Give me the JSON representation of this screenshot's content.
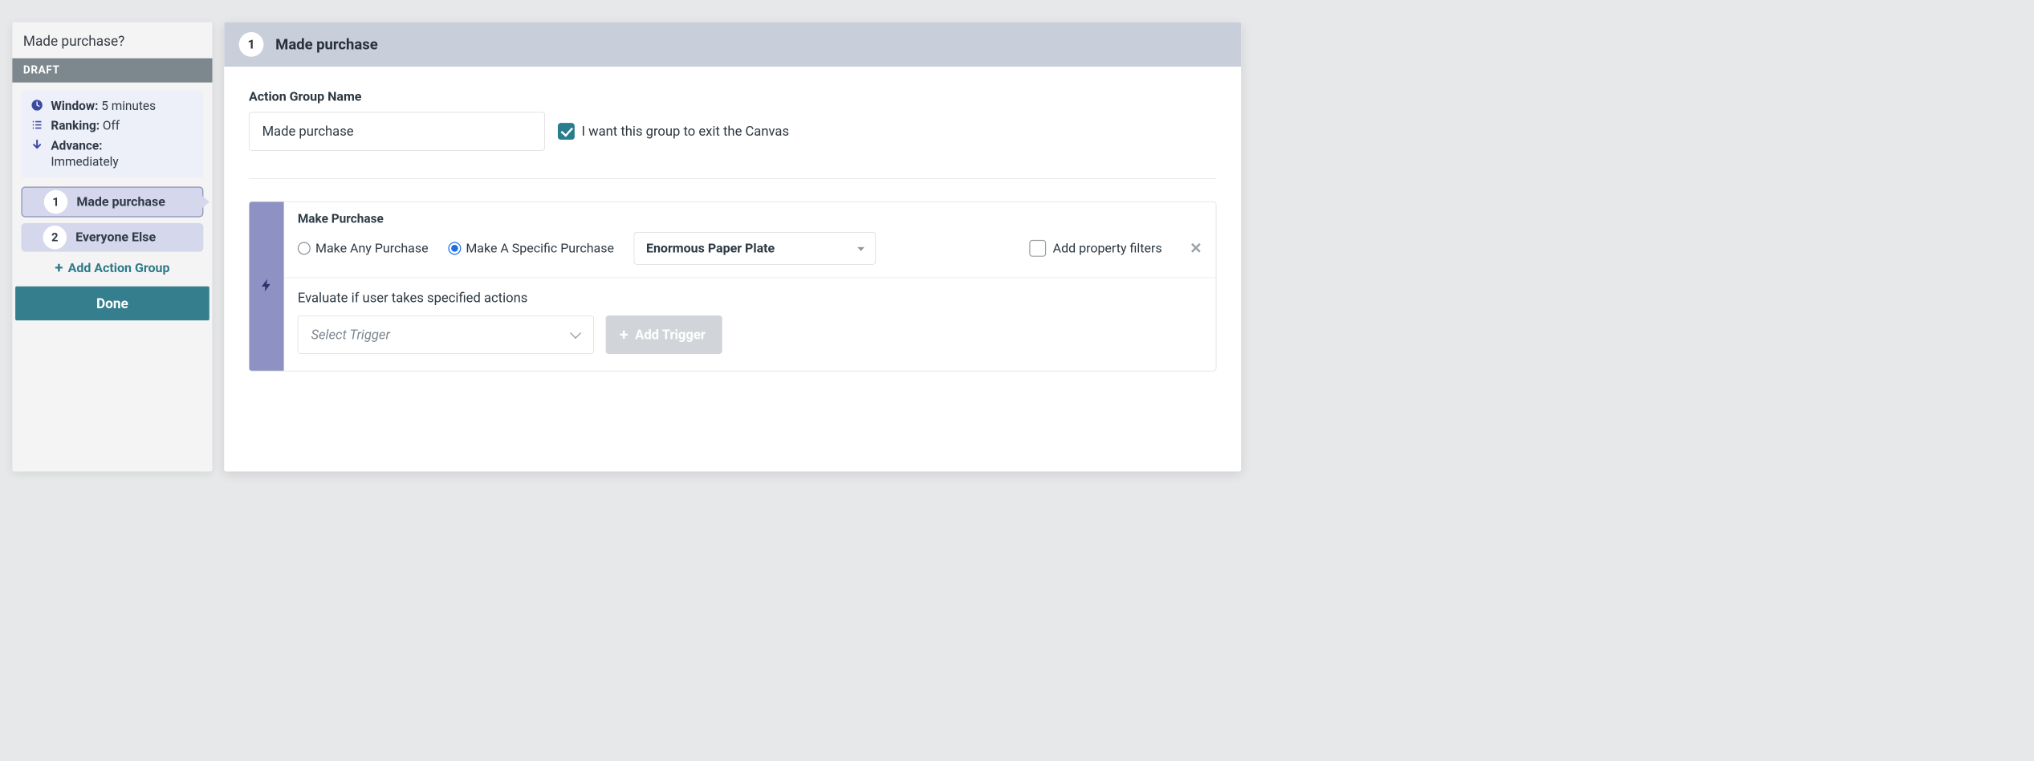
{
  "sidebar": {
    "title": "Made purchase?",
    "status": "DRAFT",
    "settings": {
      "window_label": "Window:",
      "window_value": "5 minutes",
      "ranking_label": "Ranking:",
      "ranking_value": "Off",
      "advance_label": "Advance:",
      "advance_value": "Immediately"
    },
    "groups": [
      {
        "num": "1",
        "label": "Made purchase"
      },
      {
        "num": "2",
        "label": "Everyone Else"
      }
    ],
    "add_group_label": "Add Action Group",
    "done_label": "Done"
  },
  "main": {
    "header_num": "1",
    "header_title": "Made purchase",
    "group_name_label": "Action Group Name",
    "group_name_value": "Made purchase",
    "exit_checkbox_label": "I want this group to exit the Canvas",
    "event": {
      "title": "Make Purchase",
      "radio_any_label": "Make Any Purchase",
      "radio_specific_label": "Make A Specific Purchase",
      "product_value": "Enormous Paper Plate",
      "prop_filters_label": "Add property filters",
      "instruction": "Evaluate if user takes specified actions",
      "trigger_placeholder": "Select Trigger",
      "add_trigger_label": "Add Trigger"
    }
  }
}
